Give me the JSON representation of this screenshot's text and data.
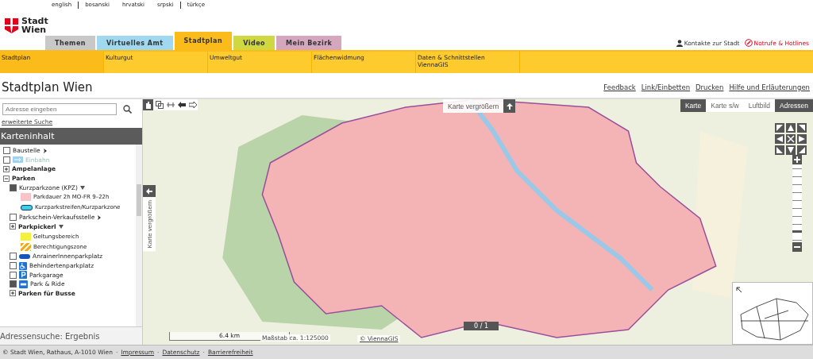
{
  "languages": [
    "english",
    "bosanski",
    "hrvatski",
    "srpski",
    "türkçe"
  ],
  "logo": {
    "text": "Stadt Wien"
  },
  "main_tabs": [
    {
      "label": "Themen",
      "color": "#c8c8c8",
      "selected": false
    },
    {
      "label": "Virtuelles Amt",
      "color": "#9fd8ef",
      "selected": false
    },
    {
      "label": "Stadtplan",
      "color": "#fbbb1a",
      "selected": true
    },
    {
      "label": "Video",
      "color": "#cfd841",
      "selected": false
    },
    {
      "label": "Mein Bezirk",
      "color": "#d4a7bf",
      "selected": false
    }
  ],
  "top_links": [
    {
      "kind": "contact",
      "label": "Kontakte zur Stadt"
    },
    {
      "kind": "emergency",
      "label": "Notrufe & Hotlines"
    }
  ],
  "sub_nav": [
    {
      "label": "Stadtplan",
      "selected": true
    },
    {
      "label": "Kulturgut",
      "selected": false
    },
    {
      "label": "Umweltgut",
      "selected": false
    },
    {
      "label": "Flächenwidmung",
      "selected": false
    },
    {
      "label": "Daten & Schnittstellen",
      "sublabel": "ViennaGIS",
      "selected": false
    }
  ],
  "page_title": "Stadtplan Wien",
  "page_links": [
    "Feedback",
    "Link/Einbetten",
    "Drucken",
    "Hilfe und Erläuterungen"
  ],
  "search": {
    "placeholder": "Adresse eingeben",
    "advanced_link": "erweiterte Suche"
  },
  "panel_title": "Karteninhalt",
  "tree": [
    {
      "kind": "layer",
      "label": "Baustelle",
      "checked": false,
      "disabled": false,
      "more": true
    },
    {
      "kind": "oneway",
      "label": "Einbahn",
      "checked": false,
      "disabled": true
    },
    {
      "kind": "group",
      "label": "Ampelanlage",
      "expanded": false
    },
    {
      "kind": "group",
      "label": "Parken",
      "expanded": true,
      "children": [
        {
          "kind": "layer",
          "label": "Kurzparkzone (KPZ)",
          "checked": true,
          "disabled": false,
          "menu": true,
          "children": [
            {
              "kind": "area",
              "label": "Parkdauer 2h MO-FR 9–22h",
              "color": "#f8c4c6"
            },
            {
              "kind": "strip",
              "label": "Kurzparkstreifen/Kurzparkzone",
              "color": "#3fd0d8"
            }
          ]
        },
        {
          "kind": "layer",
          "label": "Parkschein-Verkaufsstelle",
          "checked": false,
          "disabled": false,
          "more": true
        },
        {
          "kind": "group",
          "label": "Parkpickerl",
          "expanded": false,
          "menu": true,
          "children": [
            {
              "kind": "area",
              "label": "Geltungsbereich",
              "color": "#f4f03c"
            },
            {
              "kind": "hatch",
              "label": "Berechtigungszone",
              "color": "#f5a623"
            }
          ]
        },
        {
          "kind": "oval",
          "label": "AnrainerInnenparkplatz",
          "checked": false,
          "disabled": false
        },
        {
          "kind": "wheelchair",
          "label": "Behindertenparkplatz",
          "checked": false,
          "disabled": false
        },
        {
          "kind": "parking",
          "label": "Parkgarage",
          "checked": false,
          "disabled": false
        },
        {
          "kind": "parkride",
          "label": "Park & Ride",
          "checked": true,
          "disabled": false
        },
        {
          "kind": "group",
          "label": "Parken für Busse",
          "expanded": false
        }
      ]
    }
  ],
  "result_panel": "Adressensuche: Ergebnis",
  "map": {
    "enlarge_button": "Karte vergrößern",
    "side_enlarge": "Karte vergrößern",
    "layer_tabs": [
      {
        "label": "Karte",
        "selected": true
      },
      {
        "label": "Karte s/w",
        "selected": false
      },
      {
        "label": "Luftbild",
        "selected": false
      },
      {
        "label": "Adressen",
        "selected": true
      }
    ],
    "scale_distance": "6.4 km",
    "scale_ratio": "Maßstab ca. 1:125000",
    "copyright": "© ViennaGIS",
    "progress": {
      "text": "0 / 1",
      "level": 0
    },
    "zoom": {
      "level": 0.12
    }
  },
  "footer": {
    "text": "© Stadt Wien, Rathaus, A-1010 Wien",
    "links": [
      {
        "separator": "·",
        "label": "Impressum"
      },
      {
        "separator": "·",
        "label": "Datenschutz"
      },
      {
        "separator": "·",
        "label": "Barrierefreiheit"
      }
    ]
  }
}
